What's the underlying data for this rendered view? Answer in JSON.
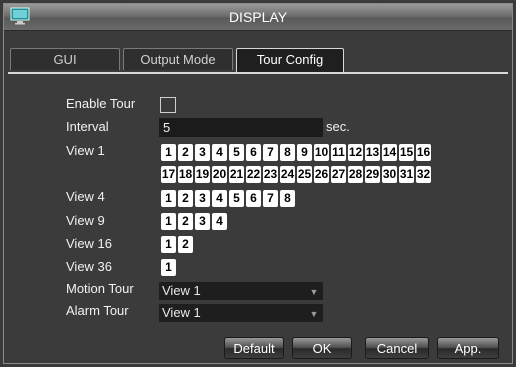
{
  "window": {
    "title": "DISPLAY"
  },
  "tabs": [
    {
      "label": "GUI"
    },
    {
      "label": "Output Mode"
    },
    {
      "label": "Tour Config"
    }
  ],
  "tour": {
    "enable_label": "Enable Tour",
    "enable_checked": false,
    "interval_label": "Interval",
    "interval_value": "5",
    "interval_unit": "sec.",
    "view1_label": "View 1",
    "view1_row1": [
      "1",
      "2",
      "3",
      "4",
      "5",
      "6",
      "7",
      "8",
      "9",
      "10",
      "11",
      "12",
      "13",
      "14",
      "15",
      "16"
    ],
    "view1_row2": [
      "17",
      "18",
      "19",
      "20",
      "21",
      "22",
      "23",
      "24",
      "25",
      "26",
      "27",
      "28",
      "29",
      "30",
      "31",
      "32"
    ],
    "view4_label": "View 4",
    "view4": [
      "1",
      "2",
      "3",
      "4",
      "5",
      "6",
      "7",
      "8"
    ],
    "view9_label": "View 9",
    "view9": [
      "1",
      "2",
      "3",
      "4"
    ],
    "view16_label": "View 16",
    "view16": [
      "1",
      "2"
    ],
    "view36_label": "View 36",
    "view36": [
      "1"
    ],
    "motion_label": "Motion Tour",
    "motion_value": "View 1",
    "alarm_label": "Alarm Tour",
    "alarm_value": "View 1"
  },
  "buttons": {
    "default": "Default",
    "ok": "OK",
    "cancel": "Cancel",
    "apply": "App."
  },
  "icons": {
    "app": "monitor-icon",
    "dropdown": "chevron-down-icon"
  },
  "colors": {
    "chip_bg": "#ffffff",
    "accent_border": "#d8d8d8"
  }
}
